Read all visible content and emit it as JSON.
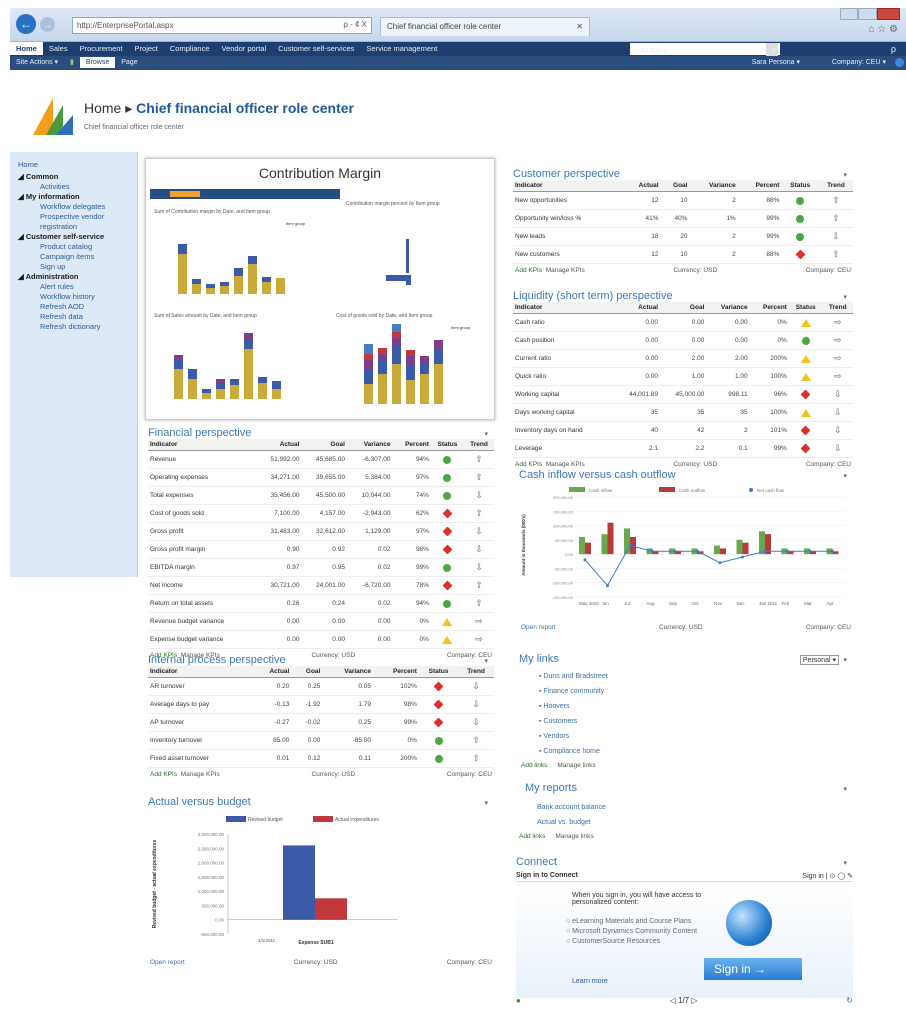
{
  "browser": {
    "url": "http://EnterprisePortal.aspx",
    "search_glyph": "ρ - ¢ X",
    "tab_title": "Chief financial officer role center"
  },
  "topnav": {
    "items": [
      "Home",
      "Sales",
      "Procurement",
      "Project",
      "Compliance",
      "Vendor portal",
      "Customer self-services",
      "Service management"
    ],
    "site_select": "All Sites"
  },
  "ribbon": {
    "site_actions": "Site Actions ▾",
    "browse": "Browse",
    "page": "Page",
    "user": "Sara Persona ▾",
    "company": "Company: CEU ▾"
  },
  "header": {
    "home": "Home",
    "sep": "▸",
    "title": "Chief financial officer role center",
    "subtitle": "Chief financial officer role center"
  },
  "leftnav": [
    {
      "t": "Home",
      "k": "link"
    },
    {
      "t": "◢ Common",
      "k": "hd"
    },
    {
      "t": "Activities",
      "k": "it"
    },
    {
      "t": "◢ My information",
      "k": "hd"
    },
    {
      "t": "Workflow delegates",
      "k": "it"
    },
    {
      "t": "Prospective vendor registration",
      "k": "it"
    },
    {
      "t": "◢ Customer self-service",
      "k": "hd"
    },
    {
      "t": "Product catalog",
      "k": "it"
    },
    {
      "t": "Campaign items",
      "k": "it"
    },
    {
      "t": "Sign up",
      "k": "it"
    },
    {
      "t": "◢ Administration",
      "k": "hd"
    },
    {
      "t": "Alert rules",
      "k": "it"
    },
    {
      "t": "Workflow history",
      "k": "it"
    },
    {
      "t": "Refresh AOD",
      "k": "it"
    },
    {
      "t": "Refresh data",
      "k": "it"
    },
    {
      "t": "Refresh dictionary",
      "k": "it"
    }
  ],
  "contribution": {
    "title": "Contribution Margin",
    "c1": "Sum of Contribution margin by Date, and Item group",
    "c2": "Contribution margin percent by Item group",
    "c3": "Sum of Sales amount by Date, and Item group",
    "c4": "Cost of goods sold by Date, and Item group",
    "legend_title": "Item group"
  },
  "kpi_headers": [
    "Indicator",
    "Actual",
    "Goal",
    "Variance",
    "Percent",
    "Status",
    "Trend"
  ],
  "financial": {
    "title": "Financial perspective",
    "rows": [
      [
        "Revenue",
        "51,992.00",
        "45,685.00",
        "-6,307.00",
        "94%",
        "g",
        "⇧"
      ],
      [
        "Operating expenses",
        "34,271.00",
        "39,655.00",
        "5,384.00",
        "97%",
        "g",
        "⇧"
      ],
      [
        "Total expenses",
        "35,456.00",
        "45,500.00",
        "10,044.00",
        "74%",
        "g",
        "⇩"
      ],
      [
        "Cost of goods sold",
        "7,100.00",
        "4,157.00",
        "-2,943.00",
        "62%",
        "r",
        "⇧"
      ],
      [
        "Gross profit",
        "31,483.00",
        "32,612.00",
        "1,129.00",
        "97%",
        "r",
        "⇩"
      ],
      [
        "Gross profit margin",
        "0.90",
        "0.92",
        "0.02",
        "98%",
        "r",
        "⇩"
      ],
      [
        "EBITDA margin",
        "0.97",
        "0.95",
        "0.02",
        "99%",
        "g",
        "⇩"
      ],
      [
        "Net income",
        "30,721.00",
        "24,001.00",
        "-6,720.00",
        "78%",
        "r",
        "⇧"
      ],
      [
        "Return on total assets",
        "0.26",
        "0.24",
        "0.02",
        "94%",
        "g",
        "⇧"
      ],
      [
        "Revenue budget variance",
        "0.00",
        "0.00",
        "0.00",
        "0%",
        "y",
        "⇨"
      ],
      [
        "Expense budget variance",
        "0.00",
        "0.00",
        "0.00",
        "0%",
        "y",
        "⇨"
      ]
    ],
    "add": "Add KPIs",
    "manage": "Manage KPIs",
    "currency": "Currency: USD",
    "company": "Company: CEU"
  },
  "internal": {
    "title": "Internal process perspective",
    "rows": [
      [
        "AR turnover",
        "0.20",
        "0.25",
        "0.05",
        "102%",
        "r",
        "⇩"
      ],
      [
        "Average days to pay",
        "-0.13",
        "-1.92",
        "1.79",
        "98%",
        "r",
        "⇩"
      ],
      [
        "AP turnover",
        "-0.27",
        "-0.02",
        "0.25",
        "99%",
        "r",
        "⇩"
      ],
      [
        "Inventory turnover",
        "85.00",
        "0.00",
        "-85.00",
        "0%",
        "g",
        "⇧"
      ],
      [
        "Fixed asset turnover",
        "0.01",
        "0.12",
        "0.11",
        "200%",
        "g",
        "⇧"
      ]
    ],
    "add": "Add KPIs",
    "manage": "Manage KPIs",
    "currency": "Currency: USD",
    "company": "Company: CEU"
  },
  "customer": {
    "title": "Customer perspective",
    "rows": [
      [
        "New opportunities",
        "12",
        "10",
        "2",
        "88%",
        "g",
        "⇧"
      ],
      [
        "Opportunity win/loss %",
        "41%",
        "40%",
        "1%",
        "99%",
        "g",
        "⇧"
      ],
      [
        "New leads",
        "18",
        "20",
        "2",
        "99%",
        "g",
        "⇩"
      ],
      [
        "New customers",
        "12",
        "10",
        "2",
        "88%",
        "r",
        "⇧"
      ]
    ],
    "add": "Add KPIs",
    "manage": "Manage KPIs",
    "currency": "Currency: USD",
    "company": "Company: CEU"
  },
  "liquidity": {
    "title": "Liquidity (short term) perspective",
    "rows": [
      [
        "Cash ratio",
        "0.00",
        "0.00",
        "0.00",
        "0%",
        "y",
        "⇨"
      ],
      [
        "Cash position",
        "0.00",
        "0.00",
        "0.00",
        "0%",
        "g",
        "⇨"
      ],
      [
        "Current ratio",
        "0.00",
        "2.00",
        "2.00",
        "200%",
        "y",
        "⇨"
      ],
      [
        "Quick ratio",
        "0.00",
        "1.00",
        "1.00",
        "100%",
        "y",
        "⇨"
      ],
      [
        "Working capital",
        "44,001.89",
        "45,000.00",
        "998.11",
        "96%",
        "r",
        "⇩"
      ],
      [
        "Days working capital",
        "35",
        "35",
        "35",
        "100%",
        "y",
        "⇩"
      ],
      [
        "Inventory days on hand",
        "40",
        "42",
        "2",
        "101%",
        "r",
        "⇩"
      ],
      [
        "Leverage",
        "2.1",
        "2.2",
        "0.1",
        "99%",
        "r",
        "⇩"
      ]
    ],
    "add": "Add KPIs",
    "manage": "Manage KPIs",
    "currency": "Currency: USD",
    "company": "Company: CEU"
  },
  "cashflow": {
    "title": "Cash inflow versus cash outflow",
    "legend": [
      "Cash inflow",
      "Cash outflow",
      "Net cash flow"
    ],
    "ylabel": "Amount in thousands (000's)",
    "open": "Open report",
    "currency": "Currency: USD",
    "company": "Company: CEU"
  },
  "budget": {
    "title": "Actual versus budget",
    "legend": [
      "Revised budget",
      "Actual expenditures"
    ],
    "ylabel": "Revised budget - actual expenditures",
    "xlabel": "Expense SUB1",
    "date": "4/1/2011",
    "open": "Open report",
    "currency": "Currency: USD",
    "company": "Company: CEU"
  },
  "chart_data": [
    {
      "type": "bar",
      "title": "Actual versus budget",
      "series": [
        {
          "name": "Revised budget",
          "values": [
            2600000
          ]
        },
        {
          "name": "Actual expenditures",
          "values": [
            750000
          ]
        }
      ],
      "categories": [
        "Expense SUB1"
      ],
      "ylim": [
        -500000,
        3000000
      ]
    },
    {
      "type": "bar",
      "title": "Cash inflow versus cash outflow",
      "categories": [
        "May 2010",
        "Jun",
        "Jul",
        "Aug",
        "Sep",
        "Oct",
        "Nov",
        "Dec",
        "Jan 2011",
        "Feb",
        "Mar",
        "Apr"
      ],
      "series": [
        {
          "name": "Cash inflow",
          "values": [
            60000,
            70000,
            90000,
            20000,
            20000,
            20000,
            30000,
            50000,
            80000,
            20000,
            20000,
            20000
          ]
        },
        {
          "name": "Cash outflow",
          "values": [
            40000,
            110000,
            60000,
            10000,
            10000,
            10000,
            20000,
            40000,
            70000,
            10000,
            10000,
            10000
          ]
        },
        {
          "name": "Net cash flow",
          "values": [
            -20000,
            -110000,
            30000,
            10000,
            10000,
            10000,
            -30000,
            -10000,
            10000,
            10000,
            10000,
            10000
          ]
        }
      ],
      "ylim": [
        -150000,
        200000
      ]
    }
  ],
  "mylinks": {
    "title": "My links",
    "view": "Personal",
    "items": [
      "Duns and Bradstreet",
      "Finance community",
      "Hoovers",
      "Customers",
      "Vendors",
      "Compliance home"
    ],
    "add": "Add links",
    "manage": "Manage links"
  },
  "myreports": {
    "title": "My reports",
    "items": [
      "Bank account balance",
      "Actual vs. budget"
    ],
    "add": "Add links",
    "manage": "Manage links"
  },
  "connect": {
    "title": "Connect",
    "signin_to": "Sign in to Connect",
    "signin_small": "Sign in |",
    "intro": "When you sign in, you will have access to personalized content:",
    "bullets": [
      "eLearning Materials and Course Plans",
      "Microsoft Dynamics Community Content",
      "CustomerSource Resources"
    ],
    "learn": "Learn more",
    "button": "Sign in →",
    "pager": "◁ 1/7 ▷"
  }
}
